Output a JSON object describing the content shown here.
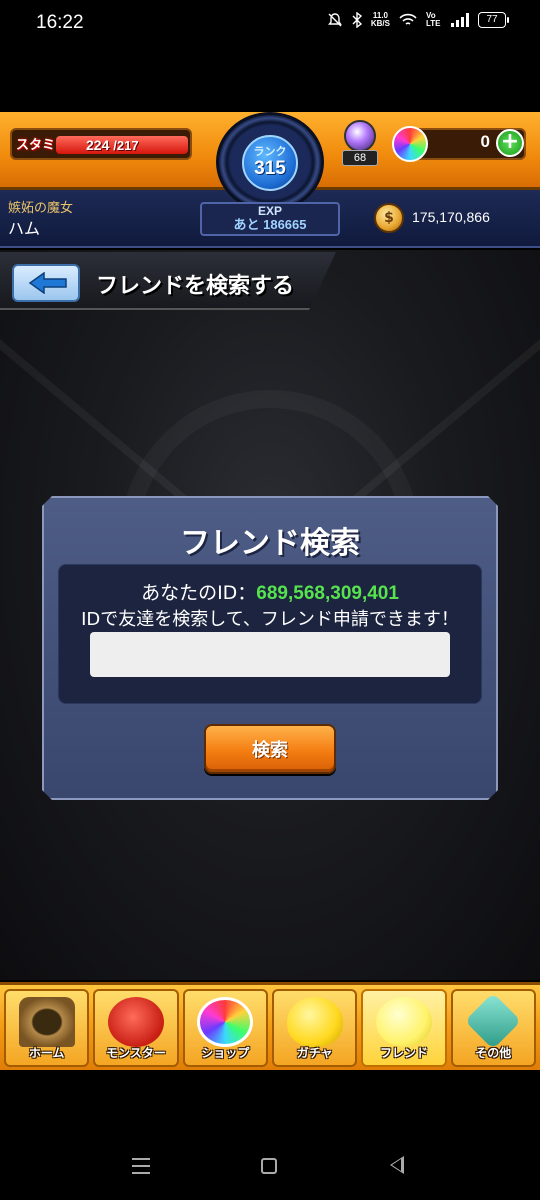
{
  "status_bar": {
    "time": "16:22",
    "net_speed": "11.0",
    "net_speed_unit": "KB/S",
    "volte": "Vo LTE",
    "battery": "77"
  },
  "header": {
    "stamina_label": "スタミナ",
    "stamina_current": "224",
    "stamina_max": "/217",
    "rank_label": "ランク",
    "rank_value": "315",
    "exp_label": "EXP",
    "exp_remaining": "あと 186665",
    "potion_count": "68",
    "orb_count": "0",
    "orb_add": "+",
    "player_title": "嫉妬の魔女",
    "player_name": "ハム",
    "gold_icon_char": "$",
    "gold_amount": "175,170,866"
  },
  "page": {
    "title": "フレンドを検索する"
  },
  "dialog": {
    "title": "フレンド検索",
    "id_label": "あなたのID：",
    "id_value": "689,568,309,401",
    "instructions": "IDで友達を検索して、フレンド申請できます！",
    "input_value": "",
    "input_placeholder": "",
    "search_button": "検索"
  },
  "tabs": [
    {
      "label": "ホーム",
      "icon": "home-gate-icon",
      "color": "#8a6a3a"
    },
    {
      "label": "モンスター",
      "icon": "monster-dragon-icon",
      "color": "#d8322a"
    },
    {
      "label": "ショップ",
      "icon": "orb-icon",
      "color": "#7bd3ff"
    },
    {
      "label": "ガチャ",
      "icon": "gacha-egg-icon",
      "color": "#ffe24a"
    },
    {
      "label": "フレンド",
      "icon": "friend-egg-icon",
      "color": "#fff36b"
    },
    {
      "label": "その他",
      "icon": "other-menu-icon",
      "color": "#54c9b2"
    }
  ],
  "colors": {
    "id_value": "#56e34e",
    "accent_orange": "#f47d12",
    "dialog_bg": "#4e5d86"
  }
}
